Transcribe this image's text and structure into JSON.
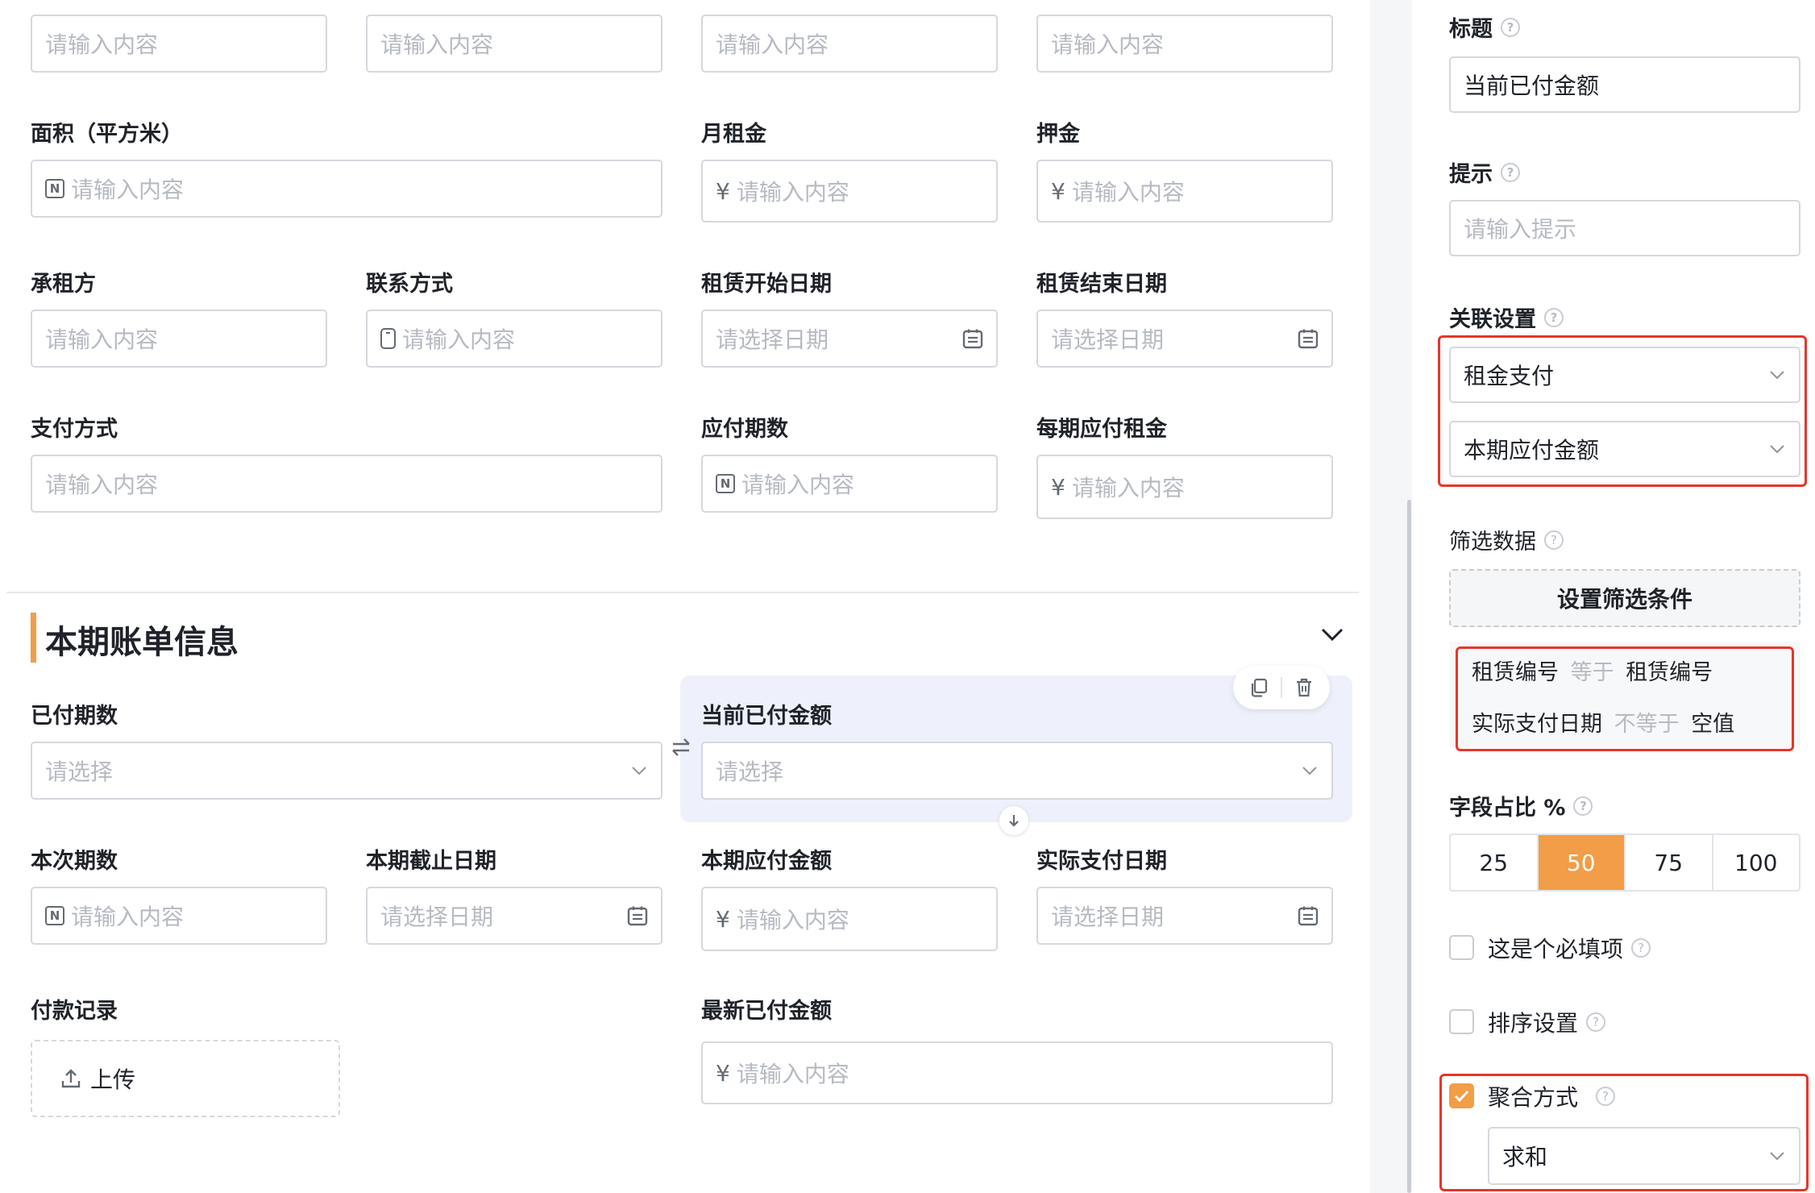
{
  "form": {
    "row0_placeholders": [
      "请输入内容",
      "请输入内容",
      "请输入内容",
      "请输入内容"
    ],
    "area_label": "面积（平方米）",
    "area_placeholder": "请输入内容",
    "monthly_rent_label": "月租金",
    "monthly_rent_placeholder": "请输入内容",
    "deposit_label": "押金",
    "deposit_placeholder": "请输入内容",
    "tenant_label": "承租方",
    "tenant_placeholder": "请输入内容",
    "contact_label": "联系方式",
    "contact_placeholder": "请输入内容",
    "lease_start_label": "租赁开始日期",
    "lease_start_placeholder": "请选择日期",
    "lease_end_label": "租赁结束日期",
    "lease_end_placeholder": "请选择日期",
    "payment_method_label": "支付方式",
    "payment_method_placeholder": "请输入内容",
    "periods_due_label": "应付期数",
    "periods_due_placeholder": "请输入内容",
    "rent_per_period_label": "每期应付租金",
    "rent_per_period_placeholder": "请输入内容",
    "currency_symbol": "¥",
    "number_symbol": "N"
  },
  "section": {
    "title": "本期账单信息",
    "accent_color": "#f29d47"
  },
  "bill": {
    "paid_periods_label": "已付期数",
    "paid_periods_placeholder": "请选择",
    "current_paid_label": "当前已付金额",
    "current_paid_placeholder": "请选择",
    "this_period_label": "本次期数",
    "this_period_placeholder": "请输入内容",
    "due_date_label": "本期截止日期",
    "due_date_placeholder": "请选择日期",
    "amount_due_label": "本期应付金额",
    "amount_due_placeholder": "请输入内容",
    "actual_date_label": "实际支付日期",
    "actual_date_placeholder": "请选择日期",
    "payment_record_label": "付款记录",
    "upload_label": "上传",
    "latest_paid_label": "最新已付金额",
    "latest_paid_placeholder": "请输入内容"
  },
  "panel": {
    "title_label": "标题",
    "title_value": "当前已付金额",
    "hint_label": "提示",
    "hint_placeholder": "请输入提示",
    "relation_label": "关联设置",
    "relation_form": "租金支付",
    "relation_field": "本期应付金额",
    "filter_label": "筛选数据",
    "filter_button": "设置筛选条件",
    "conditions": [
      {
        "field": "租赁编号",
        "op": "等于",
        "value": "租赁编号"
      },
      {
        "field": "实际支付日期",
        "op": "不等于",
        "value": "空值"
      }
    ],
    "width_label": "字段占比 %",
    "width_options": [
      "25",
      "50",
      "75",
      "100"
    ],
    "width_selected": "50",
    "required_label": "这是个必填项",
    "required_checked": false,
    "sort_label": "排序设置",
    "sort_checked": false,
    "aggregate_label": "聚合方式",
    "aggregate_checked": true,
    "aggregate_value": "求和",
    "help_glyph": "?"
  },
  "colors": {
    "accent": "#f29d47",
    "highlight_red": "#e5362b",
    "selected_field_bg": "#eef1fb",
    "border": "#d5d8de",
    "placeholder": "#b6bac2"
  }
}
